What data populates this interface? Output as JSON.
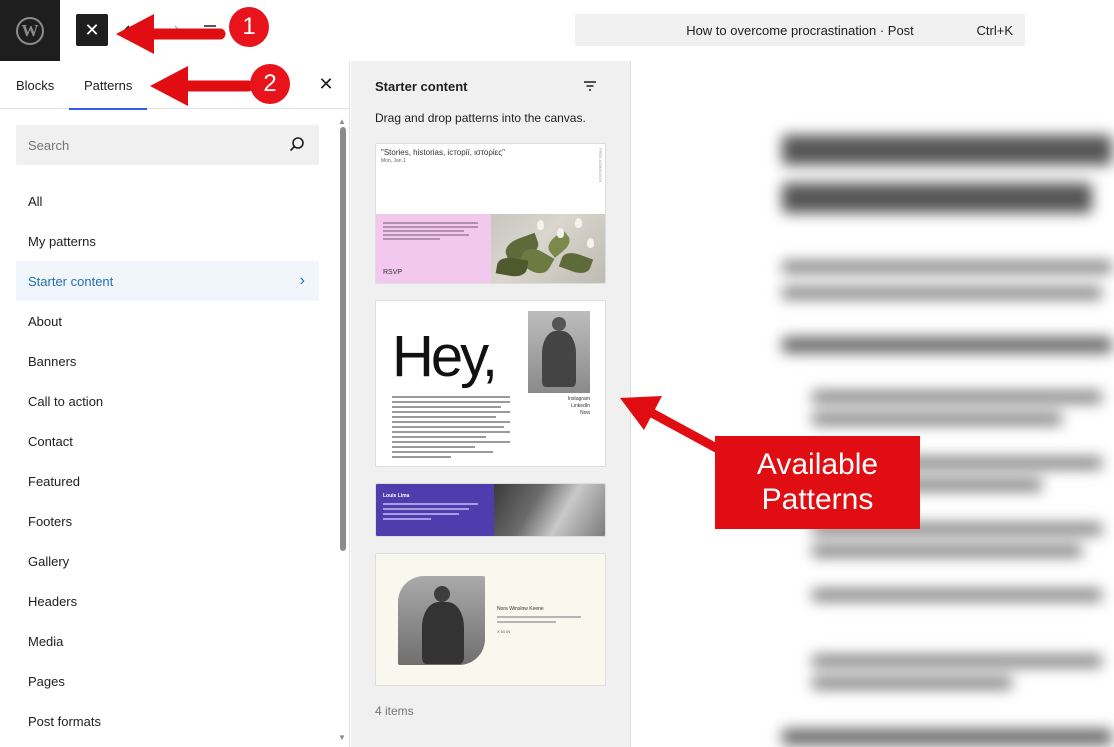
{
  "topbar": {
    "logo_icon": "wordpress-logo-icon",
    "close_label": "✕",
    "undo_icon": "undo-icon",
    "redo_icon": "redo-icon",
    "list_view_icon": "list-view-icon",
    "command_bar": {
      "title": "How to overcome procrastination · Post",
      "shortcut": "Ctrl+K"
    }
  },
  "inserter": {
    "tabs": [
      {
        "label": "Blocks",
        "active": false
      },
      {
        "label": "Patterns",
        "active": true
      }
    ],
    "close_label": "✕",
    "search": {
      "placeholder": "Search",
      "value": ""
    },
    "categories": [
      {
        "label": "All"
      },
      {
        "label": "My patterns"
      },
      {
        "label": "Starter content",
        "active": true
      },
      {
        "label": "About"
      },
      {
        "label": "Banners"
      },
      {
        "label": "Call to action"
      },
      {
        "label": "Contact"
      },
      {
        "label": "Featured"
      },
      {
        "label": "Footers"
      },
      {
        "label": "Gallery"
      },
      {
        "label": "Headers"
      },
      {
        "label": "Media"
      },
      {
        "label": "Pages"
      },
      {
        "label": "Post formats"
      }
    ],
    "active_chevron": "›"
  },
  "patterns_panel": {
    "title": "Starter content",
    "description": "Drag and drop patterns into the canvas.",
    "count_label": "4 items",
    "cards": {
      "event": {
        "heading": "\"Stories, historias, iсторії, ιστορίες\"",
        "date": "Mon, Jan 1",
        "cta": "RSVP",
        "vertical_text": "FREE ADMISSION"
      },
      "about": {
        "big_text": "Hey,",
        "links": [
          "Instagram",
          "LinkedIn",
          "Now"
        ]
      },
      "banner": {
        "name": "Louis Lima"
      },
      "profile": {
        "name": "Nora Winslow Keene",
        "social": "X  IG  IN"
      }
    }
  },
  "annotations": {
    "badge_1": "1",
    "badge_2": "2",
    "callout": "Available Patterns",
    "color": "#e00d12"
  },
  "colors": {
    "accent": "#2271b1",
    "tab_underline": "#3858e9",
    "dark": "#1e1e1e"
  }
}
